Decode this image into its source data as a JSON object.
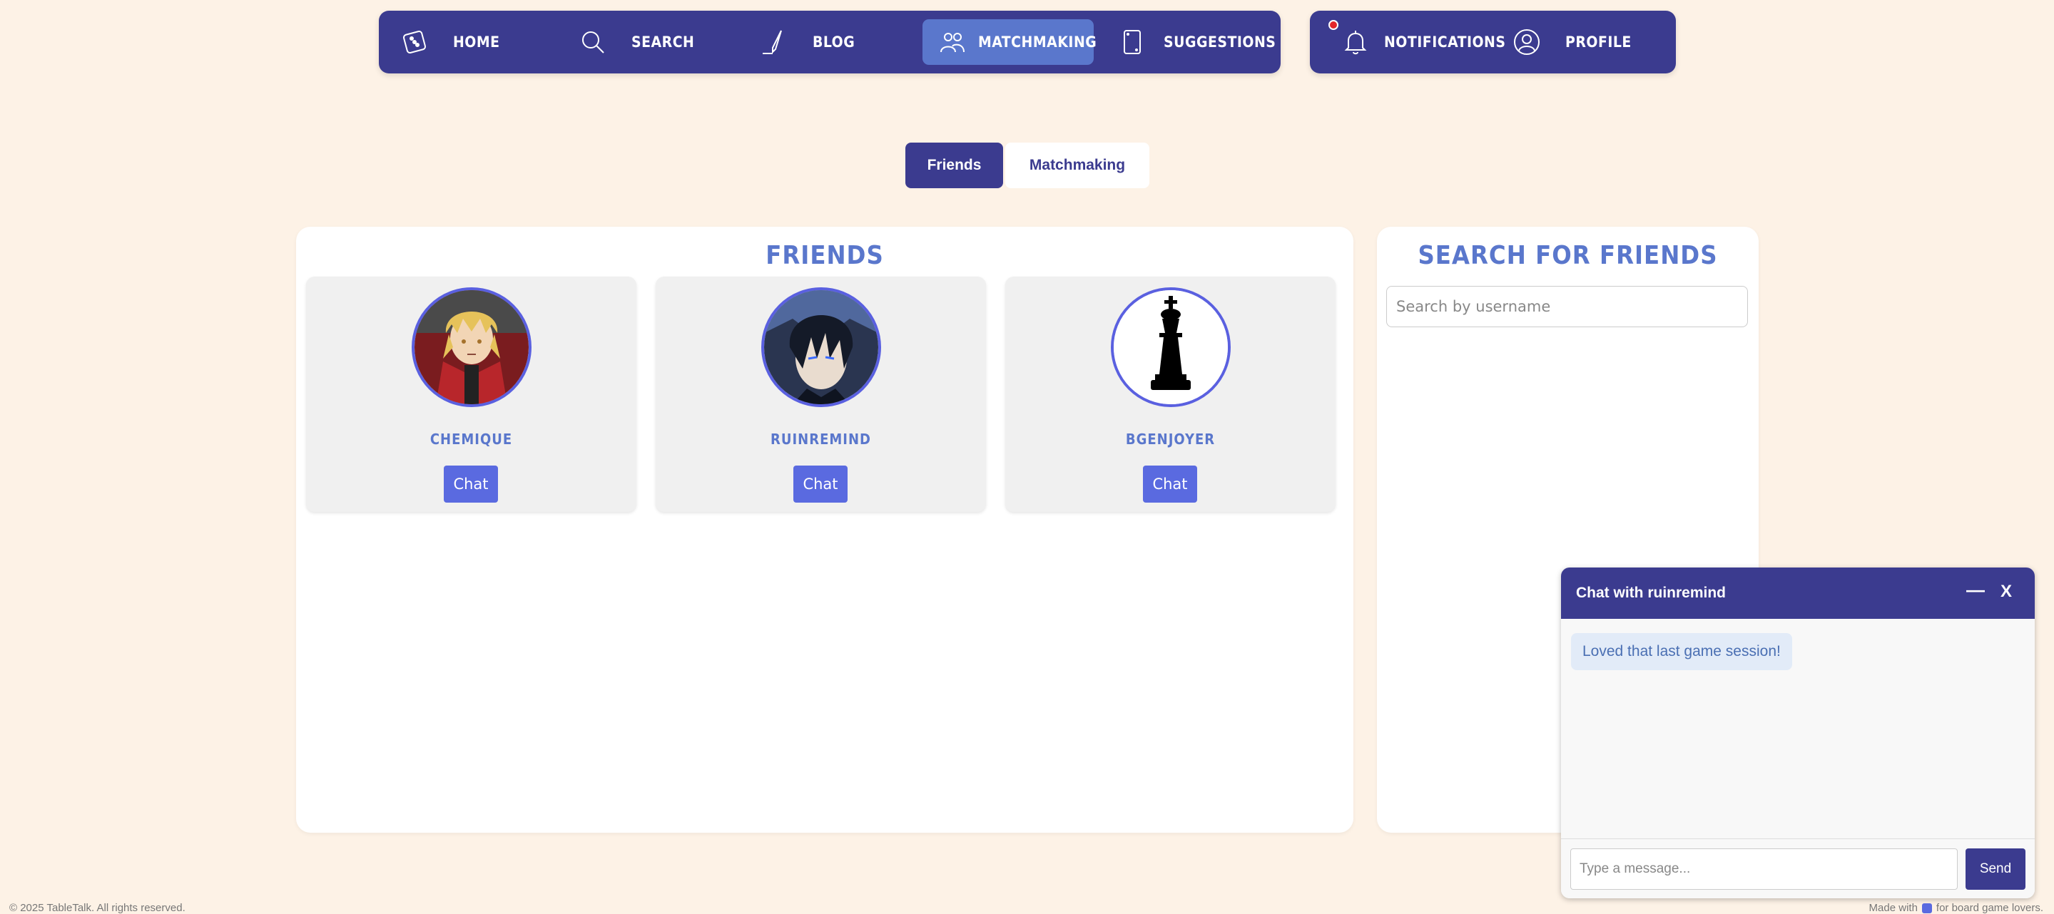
{
  "nav": {
    "items": [
      {
        "label": "HOME",
        "icon": "dice-icon"
      },
      {
        "label": "SEARCH",
        "icon": "search-icon"
      },
      {
        "label": "BLOG",
        "icon": "pen-icon"
      },
      {
        "label": "MATCHMAKING",
        "icon": "people-icon",
        "active": true
      },
      {
        "label": "SUGGESTIONS",
        "icon": "card-icon"
      }
    ],
    "right_items": [
      {
        "label": "NOTIFICATIONS",
        "icon": "bell-icon",
        "has_unread": true
      },
      {
        "label": "PROFILE",
        "icon": "user-icon"
      }
    ]
  },
  "tabs": [
    {
      "label": "Friends",
      "active": true
    },
    {
      "label": "Matchmaking",
      "active": false
    }
  ],
  "friends_panel": {
    "title": "FRIENDS",
    "friends": [
      {
        "name": "CHEMIQUE",
        "chat_label": "Chat"
      },
      {
        "name": "RUINREMIND",
        "chat_label": "Chat"
      },
      {
        "name": "BGENJOYER",
        "chat_label": "Chat"
      }
    ]
  },
  "search_panel": {
    "title": "SEARCH FOR FRIENDS",
    "placeholder": "Search by username"
  },
  "chat": {
    "title": "Chat with ruinremind",
    "minimize_label": "—",
    "close_label": "X",
    "messages": [
      {
        "text": "Loved that last game session!"
      }
    ],
    "input_placeholder": "Type a message...",
    "send_label": "Send"
  },
  "footer": {
    "copyright": "© 2025 TableTalk. All rights reserved.",
    "made_with_prefix": "Made with",
    "made_with_suffix": "for board game lovers."
  },
  "colors": {
    "primary": "#3b3b8f",
    "accent": "#5a77cc",
    "button": "#5a6ae0",
    "background": "#fdf2e6"
  }
}
